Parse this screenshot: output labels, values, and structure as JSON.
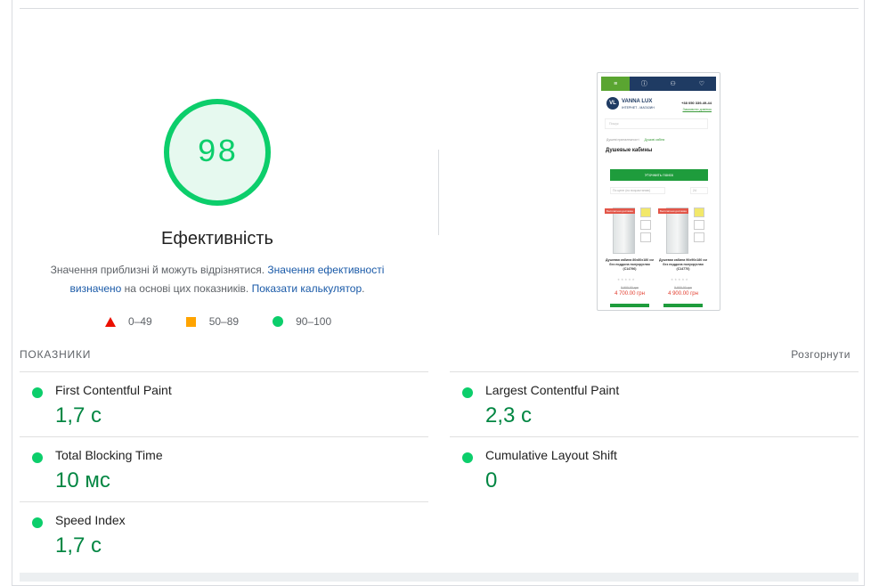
{
  "performance": {
    "score": "98",
    "title": "Ефективність",
    "desc_part1": "Значення приблизні й можуть відрізнятися. ",
    "desc_link1": "Значення ефективності визначено",
    "desc_part2": " на основі цих показників. ",
    "desc_link2": "Показати калькулятор",
    "desc_end": ".",
    "colors": {
      "pass": "#0cce6b",
      "average": "#ffa400",
      "fail": "#eb0f00",
      "pass_text": "#018642"
    }
  },
  "legend": [
    {
      "icon": "red-triangle-icon",
      "label": "0–49"
    },
    {
      "icon": "orange-square-icon",
      "label": "50–89"
    },
    {
      "icon": "green-circle-icon",
      "label": "90–100"
    }
  ],
  "screenshot": {
    "nav_icons": [
      "menu-icon",
      "info-icon",
      "user-icon",
      "heart-icon"
    ],
    "logo_initials": "VL",
    "brand": "VANNA LUX",
    "brand_sub": "ІНТЕРНЕТ - МАГАЗИН",
    "phone": "+38 050 339-49-44",
    "callback": "Замовити дзвінок",
    "search_placeholder": "Пошук",
    "crumb_1": "Душеві приналежності",
    "crumb_2": "Душові кабіни",
    "heading": "Душевые кабины",
    "filter_button": "Уточнить поиск",
    "sort": "По цене (по возрастанию)",
    "per_page": "24",
    "products": [
      {
        "badge": "Бесплатная доставка",
        "name": "Душевая кабина 80х80х180 см без поддона полукруглая (C14796)",
        "stars": "★★★★★",
        "old_price": "5 900.00 грн",
        "price": "4 700.00 грн"
      },
      {
        "badge": "Бесплатная доставка",
        "name": "Душевая кабина 90х90х180 см без поддона полукруглая (C14770)",
        "stars": "★★★★★",
        "old_price": "5 900.00 грн",
        "price": "4 900.00 грн"
      }
    ]
  },
  "metrics": {
    "header": "ПОКАЗНИКИ",
    "expand": "Розгорнути",
    "items": [
      {
        "name": "First Contentful Paint",
        "value": "1,7 с",
        "status": "pass"
      },
      {
        "name": "Largest Contentful Paint",
        "value": "2,3 с",
        "status": "pass"
      },
      {
        "name": "Total Blocking Time",
        "value": "10 мс",
        "status": "pass"
      },
      {
        "name": "Cumulative Layout Shift",
        "value": "0",
        "status": "pass"
      },
      {
        "name": "Speed Index",
        "value": "1,7 с",
        "status": "pass"
      }
    ]
  }
}
